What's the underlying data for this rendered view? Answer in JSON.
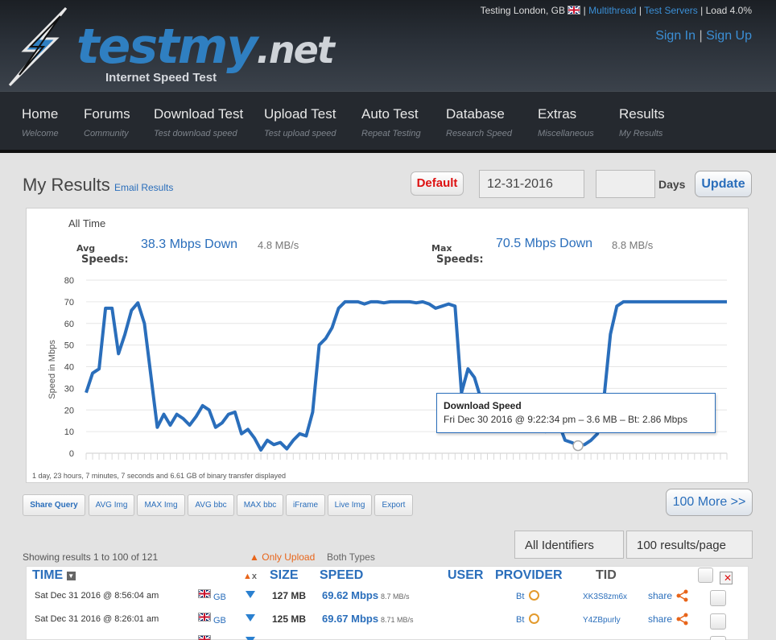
{
  "header": {
    "logo_main": "testmy",
    "logo_dotnet": ".net",
    "tagline": "Internet Speed Test",
    "location": "Testing London, GB",
    "multithread": "Multithread",
    "test_servers": "Test Servers",
    "load": "Load 4.0%",
    "sign_in": "Sign In",
    "sign_up": "Sign Up",
    "sep": "|"
  },
  "nav": [
    {
      "title": "Home",
      "sub": "Welcome"
    },
    {
      "title": "Forums",
      "sub": "Community"
    },
    {
      "title": "Download Test",
      "sub": "Test download speed"
    },
    {
      "title": "Upload Test",
      "sub": "Test upload speed"
    },
    {
      "title": "Auto Test",
      "sub": "Repeat Testing"
    },
    {
      "title": "Database",
      "sub": "Research Speed"
    },
    {
      "title": "Extras",
      "sub": "Miscellaneous"
    },
    {
      "title": "Results",
      "sub": "My Results"
    }
  ],
  "page": {
    "title": "My Results",
    "email_results": "Email Results",
    "default_btn": "Default",
    "date_value": "12-31-2016",
    "days_value": "",
    "days_label": "Days",
    "update_btn": "Update"
  },
  "stats": {
    "all_time": "All Time",
    "avg_label_1": "Avg",
    "avg_label_2": "Speeds:",
    "avg_speed": "38.3 Mbps Down",
    "avg_mbs": "4.8 MB/s",
    "max_label_1": "Max",
    "max_label_2": "Speeds:",
    "max_speed": "70.5 Mbps Down",
    "max_mbs": "8.8 MB/s",
    "footer": "1 day, 23 hours, 7 minutes, 7 seconds and 6.61 GB of binary transfer displayed"
  },
  "chart_data": {
    "type": "line",
    "ylabel": "Speed in Mbps",
    "ylim": [
      0,
      80
    ],
    "yticks": [
      "0",
      "10",
      "20",
      "30",
      "40",
      "50",
      "60",
      "70",
      "80"
    ],
    "grid": true,
    "line_color": "#2a6ebb",
    "series": [
      {
        "values": [
          28,
          37,
          39,
          67,
          67,
          46,
          55,
          66,
          69.5,
          60,
          36,
          12,
          18,
          13,
          18,
          16,
          13,
          17,
          22,
          20,
          12,
          14,
          18,
          19,
          9,
          11,
          7,
          1.5,
          6,
          4,
          5,
          2,
          6,
          9,
          8,
          19,
          50,
          53,
          58,
          67,
          70,
          70,
          70,
          69,
          70,
          70,
          69.5,
          70,
          70,
          70,
          70,
          69.5,
          70,
          69,
          67,
          68,
          69,
          68,
          28,
          39,
          35,
          25,
          20,
          15,
          12,
          18,
          20,
          22,
          17,
          20,
          22,
          10,
          12,
          14,
          6,
          5,
          3.5,
          4,
          6,
          9,
          25,
          55,
          68,
          70,
          70,
          70,
          70,
          70,
          70,
          70,
          70,
          70,
          70,
          70,
          70,
          70,
          70,
          70,
          70,
          70
        ]
      }
    ],
    "tooltip": {
      "title": "Download Speed",
      "body": "Fri Dec 30 2016 @ 9:22:34 pm – 3.6 MB – Bt: 2.86 Mbps"
    }
  },
  "toolbar": [
    "Share Query",
    "AVG Img",
    "MAX Img",
    "AVG bbc",
    "MAX bbc",
    "iFrame",
    "Live Img",
    "Export"
  ],
  "more_btn": "100 More >>",
  "filters": {
    "identifiers": "All Identifiers",
    "per_page": "100 results/page",
    "showing": "Showing results 1 to 100 of 121",
    "only_upload": "Only Upload",
    "both_types": "Both Types"
  },
  "table": {
    "headers": {
      "time": "TIME",
      "x": "x",
      "size": "SIZE",
      "speed": "SPEED",
      "user": "USER",
      "provider": "PROVIDER",
      "tid": "TID"
    },
    "rows": [
      {
        "time": "Sat Dec 31 2016 @ 8:56:04 am",
        "cc": "GB",
        "size": "127 MB",
        "speed": "69.62 Mbps",
        "mbs": "8.7 MB/s",
        "provider": "Bt",
        "tid": "XK3S8zm6x",
        "share": "share"
      },
      {
        "time": "Sat Dec 31 2016 @ 8:26:01 am",
        "cc": "GB",
        "size": "125 MB",
        "speed": "69.67 Mbps",
        "mbs": "8.71 MB/s",
        "provider": "Bt",
        "tid": "Y4ZBpurly",
        "share": "share"
      }
    ]
  },
  "colors": {
    "accent": "#2a6ebb",
    "orange": "#e8651a",
    "danger": "#d11111"
  },
  "icons": [
    "bolt-logo-icon",
    "uk-flag-icon",
    "down-arrow-icon",
    "clock-icon",
    "share-icon",
    "delete-icon",
    "sort-icon",
    "up-arrow-icon"
  ]
}
